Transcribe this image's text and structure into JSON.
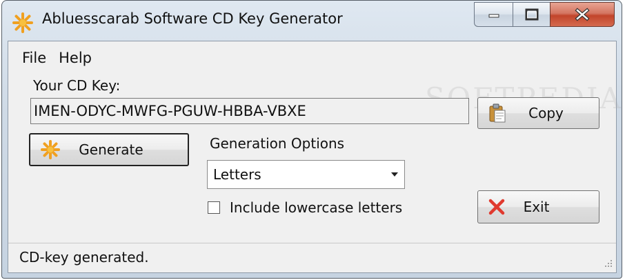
{
  "window": {
    "title": "Abluesscarab Software CD Key Generator",
    "icon": "app-star-icon"
  },
  "menu": {
    "file": "File",
    "help": "Help"
  },
  "key": {
    "label": "Your CD Key:",
    "value": "IMEN-ODYC-MWFG-PGUW-HBBA-VBXE"
  },
  "buttons": {
    "copy": "Copy",
    "generate": "Generate",
    "exit": "Exit"
  },
  "options": {
    "label": "Generation Options",
    "selected": "Letters",
    "include_lowercase_label": "Include lowercase letters",
    "include_lowercase_checked": false
  },
  "status": {
    "text": "CD-key generated."
  },
  "watermark": "SOFTPEDIA",
  "colors": {
    "accent_orange": "#f5a623",
    "close_red": "#c2452b",
    "exit_icon_red": "#e03a2f"
  }
}
